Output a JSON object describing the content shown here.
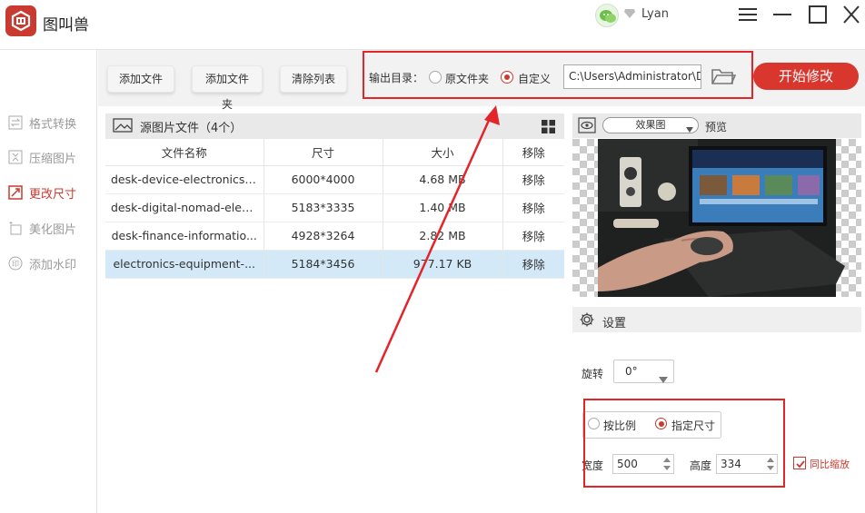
{
  "app": {
    "title": "图叫兽",
    "user": "Lyan"
  },
  "sidebar": {
    "items": [
      {
        "label": "格式转换",
        "icon": "swap-icon",
        "active": false
      },
      {
        "label": "压缩图片",
        "icon": "compress-icon",
        "active": false
      },
      {
        "label": "更改尺寸",
        "icon": "resize-icon",
        "active": true
      },
      {
        "label": "美化图片",
        "icon": "sparkle-icon",
        "active": false
      },
      {
        "label": "添加水印",
        "icon": "watermark-icon",
        "active": false
      }
    ]
  },
  "toolbar": {
    "add_file": "添加文件",
    "add_folder": "添加文件夹",
    "clear_list": "清除列表",
    "output_label": "输出目录：",
    "opt_original": "原文件夹",
    "opt_custom": "自定义",
    "output_path": "C:\\Users\\Administrator\\D",
    "start": "开始修改"
  },
  "filelist": {
    "title": "源图片文件（4个）",
    "headers": [
      "文件名称",
      "尺寸",
      "大小",
      "移除"
    ],
    "rows": [
      {
        "name": "desk-device-electronics-...",
        "size": "6000*4000",
        "filesize": "4.68 MB",
        "remove": "移除",
        "selected": false
      },
      {
        "name": "desk-digital-nomad-elec...",
        "size": "5183*3335",
        "filesize": "1.40 MB",
        "remove": "移除",
        "selected": false
      },
      {
        "name": "desk-finance-informatio...",
        "size": "4928*3264",
        "filesize": "2.82 MB",
        "remove": "移除",
        "selected": false
      },
      {
        "name": "electronics-equipment-...",
        "size": "5184*3456",
        "filesize": "977.17 KB",
        "remove": "移除",
        "selected": true
      }
    ]
  },
  "preview": {
    "mode": "效果图",
    "label": "预览"
  },
  "settings": {
    "title": "设置",
    "rotate_label": "旋转",
    "rotate_value": "0°",
    "opt_ratio": "按比例",
    "opt_size": "指定尺寸",
    "width_label": "宽度",
    "width_value": "500",
    "height_label": "高度",
    "height_value": "334",
    "keep_ratio": "同比缩放"
  },
  "colors": {
    "accent": "#d9362e",
    "annotation": "#e3252a",
    "selected_row": "#d3e9f8"
  }
}
